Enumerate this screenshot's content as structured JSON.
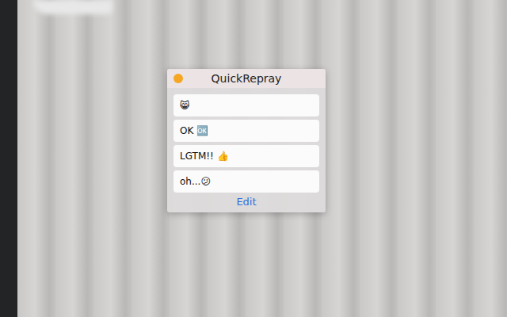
{
  "window": {
    "title": "QuickRepray"
  },
  "replies": [
    {
      "text": "😸"
    },
    {
      "text": "OK 🆗"
    },
    {
      "text": "LGTM!! 👍"
    },
    {
      "text": "oh...😕"
    }
  ],
  "buttons": [
    "Edit"
  ]
}
